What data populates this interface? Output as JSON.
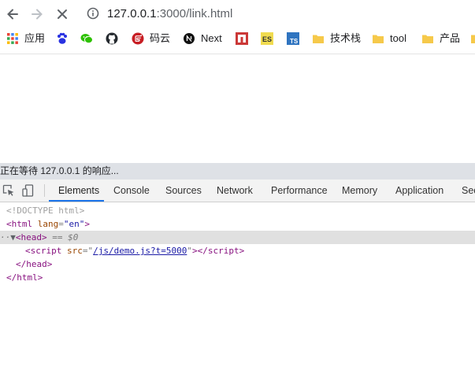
{
  "browser": {
    "url_host": "127.0.0.1",
    "url_path": ":3000/link.html",
    "bookmarks": [
      {
        "label": "应用",
        "icon": "apps-grid-icon"
      },
      {
        "label": "",
        "icon": "baidu-paw-icon"
      },
      {
        "label": "",
        "icon": "wechat-icon"
      },
      {
        "label": "",
        "icon": "github-icon"
      },
      {
        "label": "码云",
        "icon": "gitee-icon"
      },
      {
        "label": "Next",
        "icon": "nextjs-icon"
      },
      {
        "label": "",
        "icon": "npm-icon"
      },
      {
        "label": "",
        "icon": "es-icon"
      },
      {
        "label": "",
        "icon": "ts-icon"
      },
      {
        "label": "技术栈",
        "icon": "folder-icon"
      },
      {
        "label": "tool",
        "icon": "folder-icon"
      },
      {
        "label": "产品",
        "icon": "folder-icon"
      }
    ],
    "es_text": "ES",
    "ts_text": "TS"
  },
  "status": {
    "text": "正在等待 127.0.0.1 的响应..."
  },
  "devtools": {
    "tabs": [
      "Elements",
      "Console",
      "Sources",
      "Network",
      "Performance",
      "Memory",
      "Application",
      "Sec"
    ],
    "active_tab": "Elements",
    "dom": {
      "doctype": "<!DOCTYPE html>",
      "html_open_tag": "html",
      "html_attr_name": "lang",
      "html_attr_value": "\"en\"",
      "head_tag": "head",
      "eq_marker": " == $0",
      "script_tag": "script",
      "script_attr_name": "src",
      "script_src": "/js/demo.js?t=5000",
      "head_close": "</head>",
      "html_close": "</html>"
    }
  },
  "colors": {
    "accent": "#1a73e8",
    "status_bg": "#dee1e6",
    "selected_row": "#e0e0e0"
  }
}
